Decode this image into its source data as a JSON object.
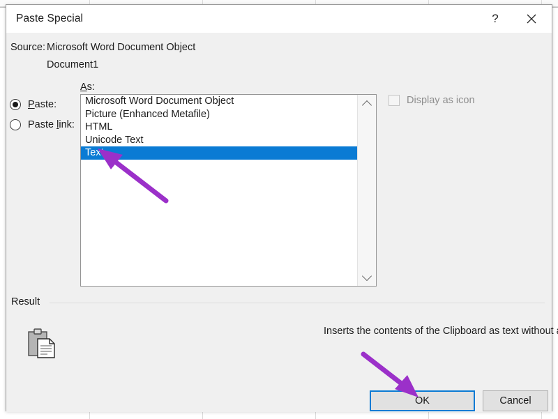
{
  "dialog": {
    "title": "Paste Special",
    "help_button": "?",
    "close_button": "close-icon"
  },
  "source": {
    "label": "Source:",
    "value_line1": "Microsoft Word Document Object",
    "value_line2": "Document1"
  },
  "paste_mode": {
    "as_label": "As:",
    "options": [
      {
        "label": "Paste:",
        "accel": "P",
        "selected": true
      },
      {
        "label": "Paste link:",
        "accel": "l",
        "selected": false
      }
    ]
  },
  "format_list": {
    "items": [
      {
        "label": "Microsoft Word Document Object",
        "selected": false
      },
      {
        "label": "Picture (Enhanced Metafile)",
        "selected": false
      },
      {
        "label": "HTML",
        "selected": false
      },
      {
        "label": "Unicode Text",
        "selected": false
      },
      {
        "label": "Text",
        "selected": true
      }
    ],
    "scroll_up_icon": "chevron-up-icon",
    "scroll_down_icon": "chevron-down-icon"
  },
  "display_as_icon": {
    "label": "Display as icon",
    "checked": false,
    "enabled": false
  },
  "result": {
    "group_label": "Result",
    "icon": "clipboard-paste-icon",
    "description": "Inserts the contents of the Clipboard as text without any formatting."
  },
  "buttons": {
    "ok": "OK",
    "cancel": "Cancel"
  },
  "colors": {
    "selection_blue": "#0a7bd4",
    "focus_border": "#0a7bd4",
    "dialog_background": "#f0f0f0",
    "titlebar_background": "#ffffff",
    "annotation_purple": "#9b30c9"
  },
  "annotations": [
    {
      "name": "arrow-to-text-item",
      "points_to": "Text",
      "color": "#9b30c9"
    },
    {
      "name": "arrow-to-ok-button",
      "points_to": "OK",
      "color": "#9b30c9"
    }
  ]
}
